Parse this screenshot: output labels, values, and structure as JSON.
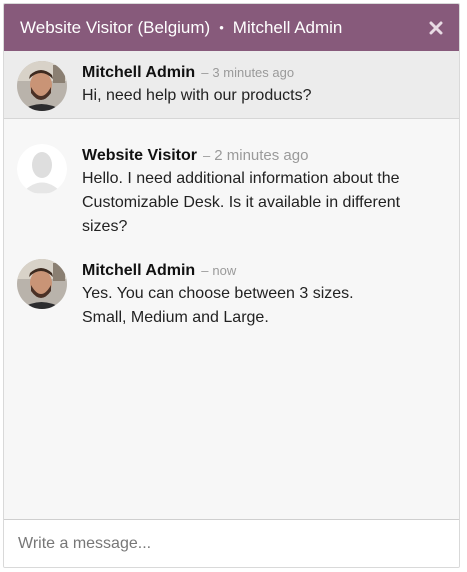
{
  "header": {
    "visitor_label": "Website Visitor (Belgium)",
    "separator": "•",
    "operator_name": "Mitchell Admin",
    "close_icon": "close-icon",
    "background_color": "#875a7b"
  },
  "messages": [
    {
      "author": "Mitchell Admin",
      "time": "3 minutes ago",
      "text": "Hi, need help with our products?"
    },
    {
      "author": "Website Visitor",
      "time": "2 minutes ago",
      "text": "Hello. I need additional information about the Customizable Desk. Is it available in different sizes?"
    },
    {
      "author": "Mitchell Admin",
      "time": "now",
      "text": "Yes. You can choose between 3 sizes. Small, Medium and Large."
    }
  ],
  "composer": {
    "placeholder": "Write a message..."
  },
  "meta": {
    "time_separator": "–"
  }
}
